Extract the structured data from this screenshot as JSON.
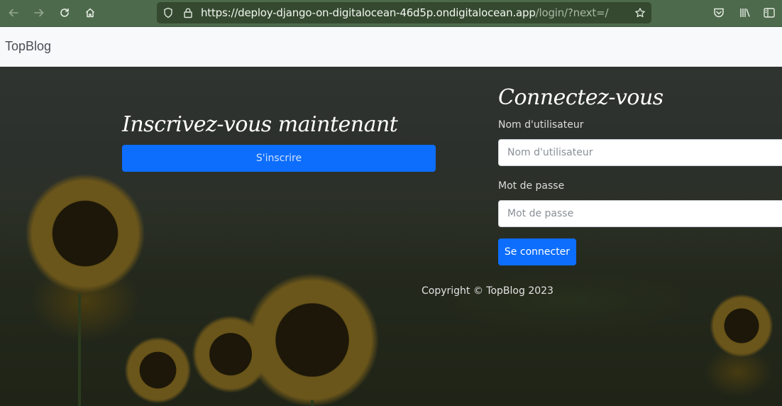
{
  "browser": {
    "url_host": "https://deploy-django-on-digitalocean-46d5p.ondigitalocean.app",
    "url_path": "/login/?next=/"
  },
  "site": {
    "brand": "TopBlog"
  },
  "signup": {
    "title": "Inscrivez-vous maintenant",
    "button_label": "S'inscrire"
  },
  "login": {
    "title": "Connectez-vous",
    "username_label": "Nom d'utilisateur",
    "username_placeholder": "Nom d'utilisateur",
    "password_label": "Mot de passe",
    "password_placeholder": "Mot de passe",
    "submit_label": "Se connecter"
  },
  "footer": {
    "copyright": "Copyright © TopBlog 2023"
  },
  "colors": {
    "primary": "#0d6efd",
    "toolbar": "#4e6a4c"
  },
  "icons": [
    "back-arrow-icon",
    "forward-arrow-icon",
    "reload-icon",
    "home-icon",
    "shield-icon",
    "lock-icon",
    "star-icon",
    "pocket-icon",
    "library-icon",
    "sidebar-icon"
  ]
}
